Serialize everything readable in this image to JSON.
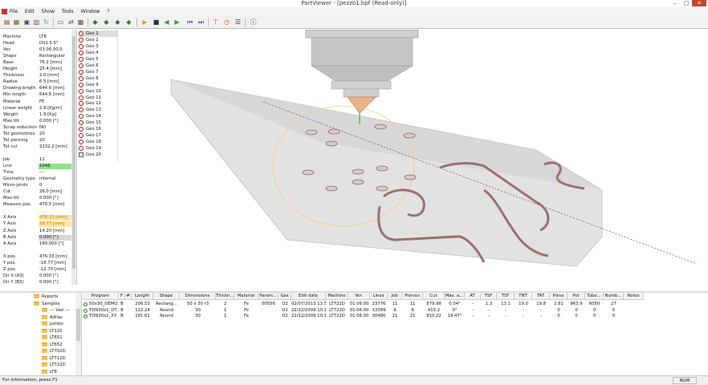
{
  "window": {
    "title": "PartViewer - [pezzo1.bpf (Read-only)]"
  },
  "menu": [
    "File",
    "Edit",
    "Show",
    "Tools",
    "Window",
    "?"
  ],
  "properties": [
    {
      "k": "Machine",
      "v": "LT8"
    },
    {
      "k": "Head",
      "v": "DS1.5-5\""
    },
    {
      "k": "Ver.",
      "v": "03.06.00.0"
    },
    {
      "k": "Shape",
      "v": "Rectangular"
    },
    {
      "k": "Base",
      "v": "76.2 [mm]"
    },
    {
      "k": "Height",
      "v": "25.4 [mm]"
    },
    {
      "k": "Thickness",
      "v": "2.0 [mm]"
    },
    {
      "k": "Radius",
      "v": "6.5 [mm]"
    },
    {
      "k": "Drawing length",
      "v": "644.6 [mm]"
    },
    {
      "k": "Min length",
      "v": "644.6 [mm]"
    },
    {
      "k": "Material",
      "v": "FE"
    },
    {
      "k": "Linear weight",
      "v": "2.9 [Kg/m]"
    },
    {
      "k": "Weight",
      "v": "1.9 [Kg]"
    },
    {
      "k": "Max tilt",
      "v": "0.000 [°]"
    },
    {
      "k": "Scrap reduction",
      "v": "NO"
    },
    {
      "k": "Tot geometries",
      "v": "20"
    },
    {
      "k": "Tot piercing",
      "v": "20"
    },
    {
      "k": "Tot cut",
      "v": "2232.2 [mm]"
    },
    {
      "k": "",
      "v": ""
    },
    {
      "k": "Job",
      "v": "11"
    },
    {
      "k": "Line",
      "v": "1048",
      "hl": "green"
    },
    {
      "k": "Time",
      "v": "---"
    },
    {
      "k": "Geometry type",
      "v": "internal"
    },
    {
      "k": "Micro-joints",
      "v": "0"
    },
    {
      "k": "Cut",
      "v": "26.0 [mm]"
    },
    {
      "k": "Max tilt",
      "v": "0.000 [°]"
    },
    {
      "k": "Measure pos.",
      "v": "478.5 [mm]"
    },
    {
      "k": "",
      "v": ""
    },
    {
      "k": "X Axis",
      "v": "476.33 [mm]",
      "hl": "yellow"
    },
    {
      "k": "Y Axis",
      "v": "18.77 [mm]",
      "hl": "yellow"
    },
    {
      "k": "Z Axis",
      "v": "14.20 [mm]"
    },
    {
      "k": "B Axis",
      "v": "0.000 [°]",
      "hl": "gray"
    },
    {
      "k": "A Axis",
      "v": "180.000 [°]"
    },
    {
      "k": "",
      "v": ""
    },
    {
      "k": "X pos.",
      "v": "476.33 [mm]"
    },
    {
      "k": "Y pos.",
      "v": "-18.77 [mm]"
    },
    {
      "k": "Z pos.",
      "v": "-12.70 [mm]"
    },
    {
      "k": "Dir X (A3)",
      "v": "0.000 [°]"
    },
    {
      "k": "Dir Y (B3)",
      "v": "0.000 [°]"
    },
    {
      "k": "Dir Z (C3)",
      "v": "-1.000 [°]"
    },
    {
      "k": "",
      "v": ""
    },
    {
      "k": "Inclination",
      "v": "0.000 [°]"
    },
    {
      "k": "Thickness",
      "v": "2.000 (100.0%)"
    },
    {
      "k": "Laser power",
      "v": "7.0 [W]"
    }
  ],
  "geometries": [
    "Geo 1",
    "Geo 2",
    "Geo 3",
    "Geo 4",
    "Geo 5",
    "Geo 6",
    "Geo 7",
    "Geo 8",
    "Geo 9",
    "Geo 10",
    "Geo 11",
    "Geo 12",
    "Geo 13",
    "Geo 14",
    "Geo 15",
    "Geo 16",
    "Geo 17",
    "Geo 18",
    "Geo 19",
    "Geo 20"
  ],
  "tree": [
    {
      "label": "Reports",
      "indent": 1
    },
    {
      "label": "Samples",
      "indent": 1
    },
    {
      "label": "--- Vari ---",
      "indent": 2
    },
    {
      "label": "Adilas",
      "indent": 2
    },
    {
      "label": "Jumbo",
      "indent": 2
    },
    {
      "label": "LT120",
      "indent": 2
    },
    {
      "label": "LT651",
      "indent": 2
    },
    {
      "label": "LT652",
      "indent": 2
    },
    {
      "label": "LT702D",
      "indent": 2
    },
    {
      "label": "LT712D",
      "indent": 2
    },
    {
      "label": "LT722D",
      "indent": 2
    },
    {
      "label": "LT8",
      "indent": 2
    }
  ],
  "table": {
    "headers": [
      "Program",
      "F",
      "#",
      "Length",
      "Shape",
      "Dimensions",
      "Thickn...",
      "Material",
      "Param...",
      "Gas",
      "Edit date",
      "Machine",
      "Ver.",
      "Lines",
      "Job",
      "Pierces",
      "Cut",
      "Max. a...",
      "AT",
      "TSF",
      "TST",
      "TNT",
      "TAT",
      "Press",
      "Pot",
      "Tube...",
      "Numb...",
      "Notes"
    ],
    "rows": [
      [
        "50x30_DEMO...",
        "B",
        "",
        "206.53",
        "Rectang...",
        "50 x 30 r3",
        "2",
        "Fe",
        "00556",
        "O2",
        "02/07/2013 11:55",
        "LT722D",
        "01.06.00",
        "23776",
        "11",
        "11",
        "879.98",
        "0.04°",
        "-",
        "1.3",
        "13.1",
        "19.0",
        "19.8",
        "2.81",
        "963.9",
        "6050",
        "27",
        ""
      ],
      [
        "TON30x1_DT...",
        "B",
        "",
        "122.24",
        "Round",
        "30",
        "1",
        "Fe",
        "",
        "O2",
        "22/12/2009 10:17",
        "LT722D",
        "01.06.00",
        "13389",
        "6",
        "6",
        "415.2",
        "0°",
        "-",
        "-",
        "-",
        "-",
        "-",
        "0",
        "0",
        "0",
        "0",
        ""
      ],
      [
        "TON30x1_XY...",
        "B",
        "",
        "181.61",
        "Round",
        "30",
        "1",
        "Fe",
        "",
        "O2",
        "22/12/2009 10:17",
        "LT722D",
        "01.06.00",
        "30480",
        "21",
        "21",
        "810.22",
        "19.47°",
        "-",
        "-",
        "-",
        "-",
        "-",
        "0",
        "0",
        "0",
        "0",
        ""
      ]
    ]
  },
  "status": {
    "text": "For information, press F1",
    "num": "NUM"
  },
  "colors": {
    "close": "#c7412f",
    "green": "#8fe28b",
    "yellow": "#fbe6a3"
  }
}
